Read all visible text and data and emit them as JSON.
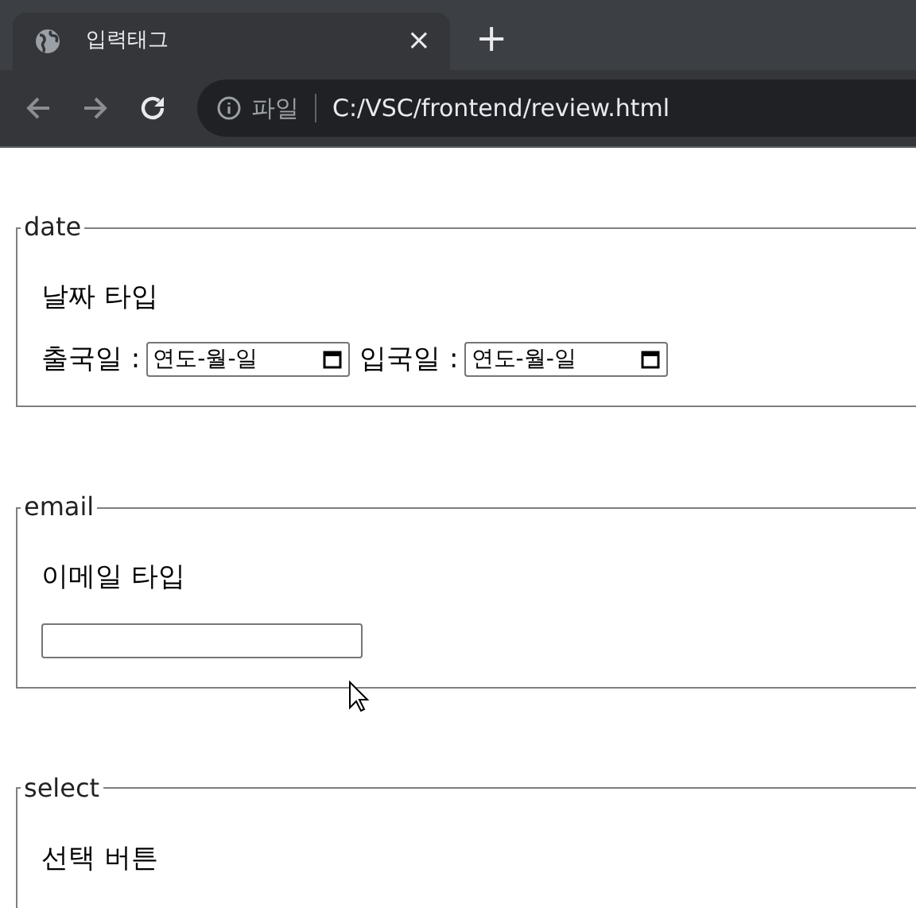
{
  "browser": {
    "tab": {
      "title": "입력태그",
      "close_glyph": "×"
    },
    "new_tab_glyph": "+",
    "address": {
      "scheme_label": "파일",
      "url": "C:/VSC/frontend/review.html"
    }
  },
  "sections": [
    {
      "kind": "date",
      "legend": "date",
      "heading": "날짜 타입",
      "fields": [
        {
          "label": "출국일 :",
          "placeholder": "연도-월-일"
        },
        {
          "label": "입국일 :",
          "placeholder": "연도-월-일"
        }
      ]
    },
    {
      "kind": "email",
      "legend": "email",
      "heading": "이메일 타입"
    },
    {
      "kind": "select",
      "legend": "select",
      "heading": "선택 버튼"
    }
  ]
}
